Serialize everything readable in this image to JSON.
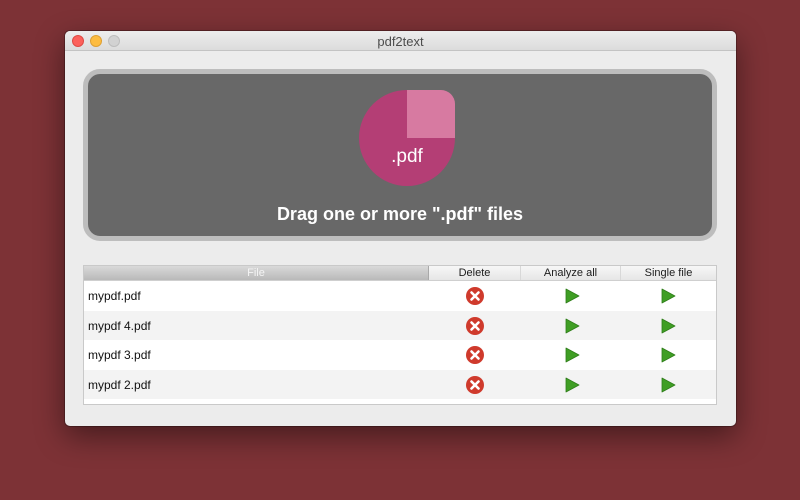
{
  "window": {
    "title": "pdf2text"
  },
  "dropzone": {
    "file_ext": ".pdf",
    "prompt": "Drag one or more \".pdf\" files"
  },
  "table": {
    "columns": {
      "file": "File",
      "delete": "Delete",
      "analyze": "Analyze all",
      "single": "Single file"
    },
    "rows": [
      {
        "name": "mypdf.pdf"
      },
      {
        "name": "mypdf 4.pdf"
      },
      {
        "name": "mypdf 3.pdf"
      },
      {
        "name": "mypdf 2.pdf"
      }
    ]
  },
  "colors": {
    "background": "#7d3236",
    "dropzone": "#686868",
    "pdf_icon": "#b43e75",
    "delete": "#cf3a2c",
    "play": "#3f9e24"
  },
  "icons": {
    "delete": "close-circle-icon",
    "analyze": "play-icon",
    "single": "play-icon",
    "file": "pdf-file-icon"
  }
}
